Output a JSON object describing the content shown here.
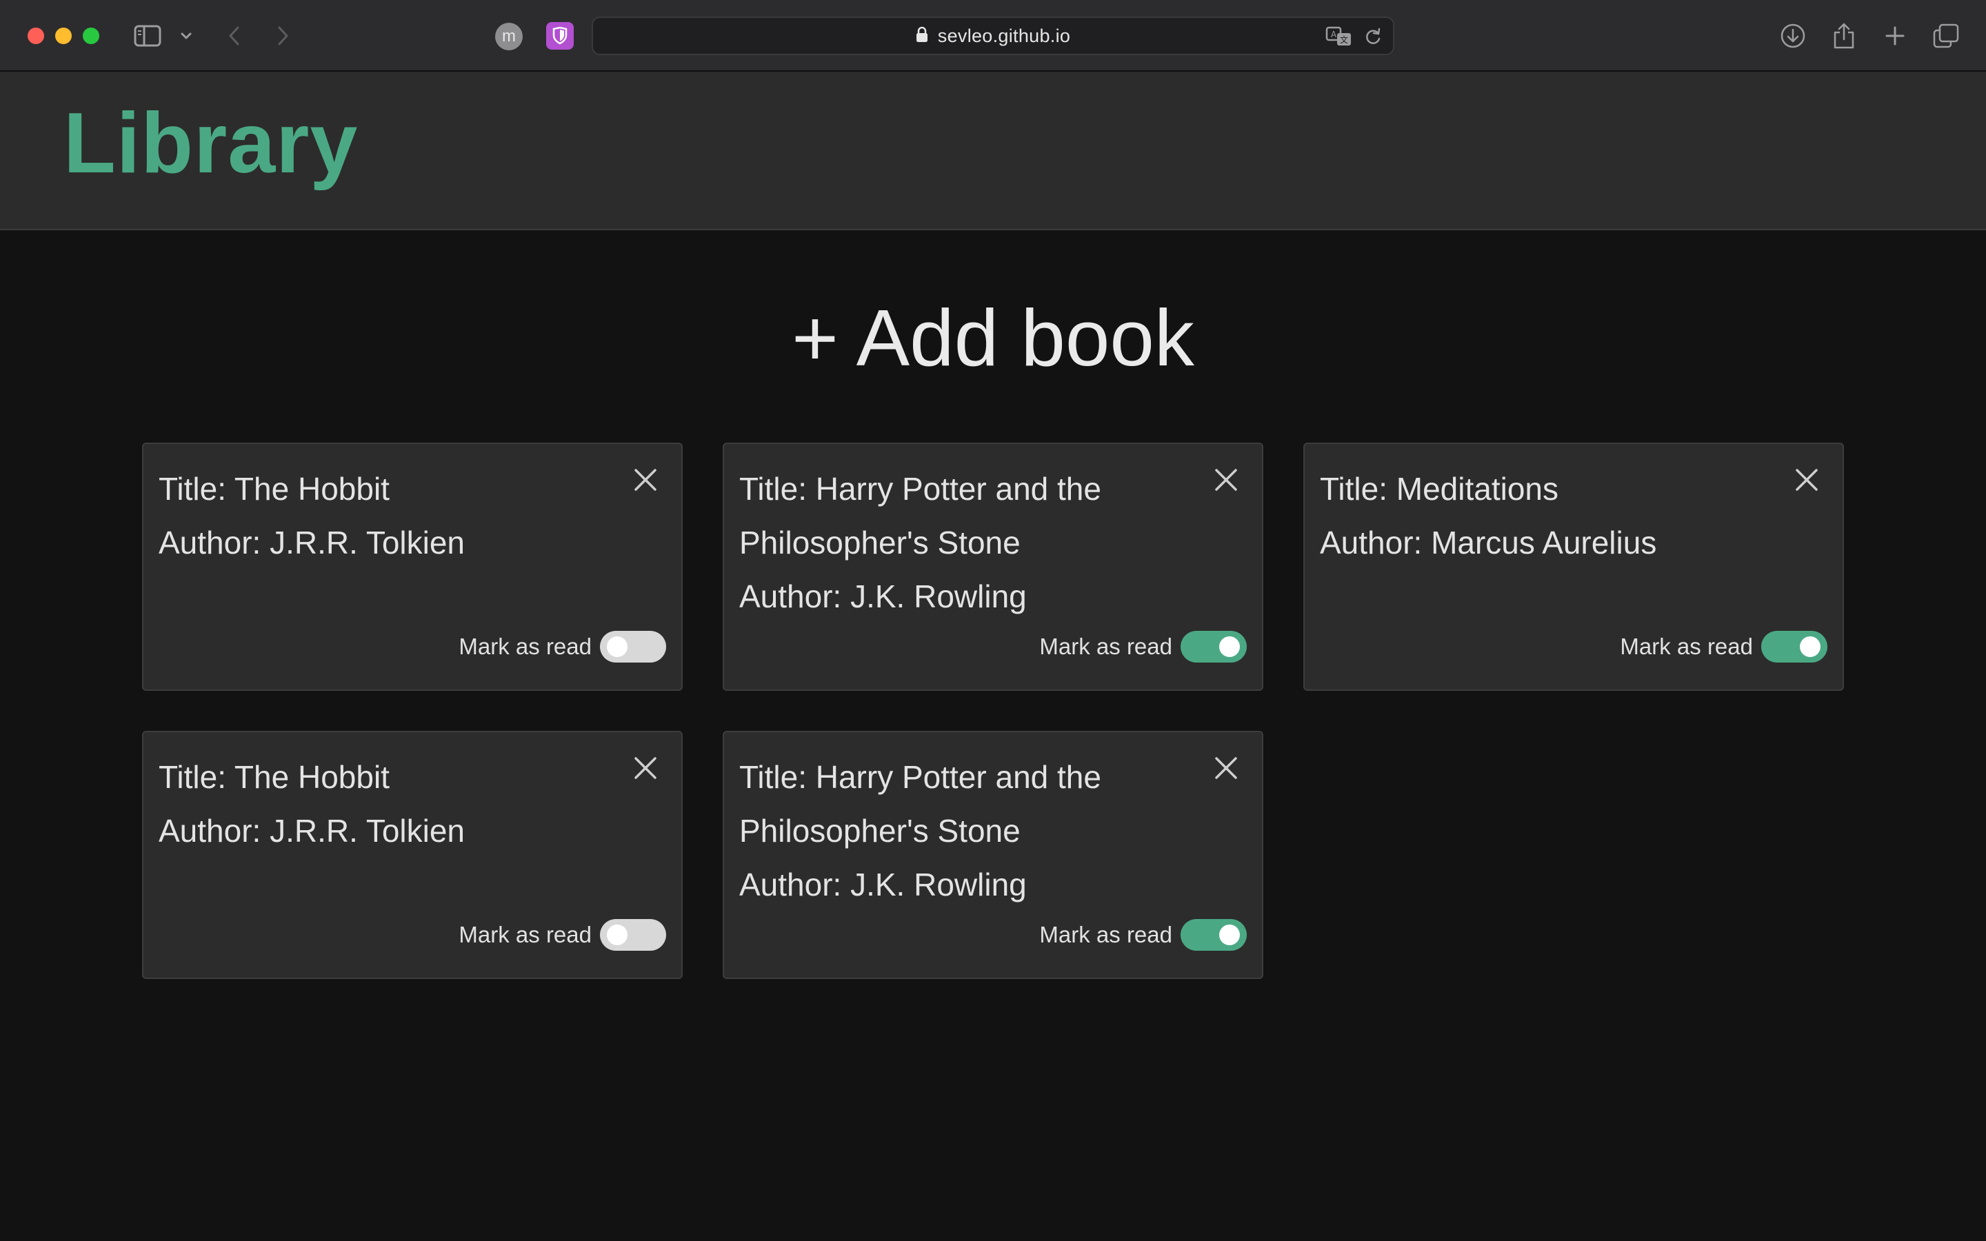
{
  "browser": {
    "url": "sevleo.github.io",
    "profile_initial": "m"
  },
  "header": {
    "title": "Library"
  },
  "add_book_label": "+ Add book",
  "books": [
    {
      "title_line_1": "Title: The Hobbit",
      "title_line_2": "",
      "author_line": "Author: J.R.R. Tolkien",
      "read_label": "Mark as read",
      "read": false
    },
    {
      "title_line_1": "Title: Harry Potter and the",
      "title_line_2": "Philosopher's Stone",
      "author_line": "Author: J.K. Rowling",
      "read_label": "Mark as read",
      "read": true
    },
    {
      "title_line_1": "Title: Meditations",
      "title_line_2": "",
      "author_line": "Author: Marcus Aurelius",
      "read_label": "Mark as read",
      "read": true
    },
    {
      "title_line_1": "Title: The Hobbit",
      "title_line_2": "",
      "author_line": "Author: J.R.R. Tolkien",
      "read_label": "Mark as read",
      "read": false
    },
    {
      "title_line_1": "Title: Harry Potter and the",
      "title_line_2": "Philosopher's Stone",
      "author_line": "Author: J.K. Rowling",
      "read_label": "Mark as read",
      "read": true
    }
  ],
  "colors": {
    "accent": "#4aa984",
    "background": "#121212",
    "card": "#2c2c2c"
  }
}
